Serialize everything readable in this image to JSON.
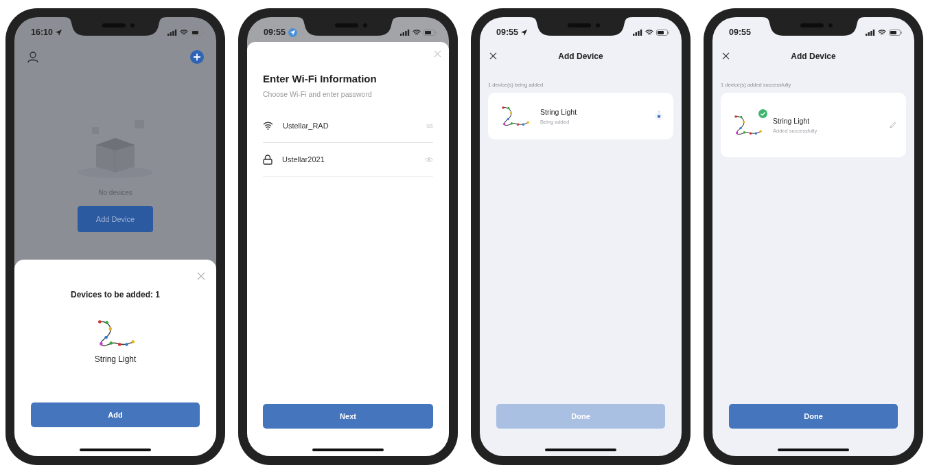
{
  "phones": [
    {
      "kind": "home_sheet",
      "time": "16:10",
      "location_icon": {
        "kind": "arrow"
      },
      "empty_text": "No devices",
      "home_button": "Add Device",
      "sheet_title": "Devices to be added: 1",
      "device_name": "String Light",
      "sheet_button": "Add"
    },
    {
      "kind": "wifi_form",
      "time": "09:55",
      "location_icon": {
        "kind": "badge"
      },
      "title": "Enter Wi-Fi Information",
      "subtitle": "Choose Wi-Fi and enter password",
      "fields": [
        {
          "kind": "network",
          "value": "Ustellar_RAD"
        },
        {
          "kind": "password",
          "value": "Ustellar2021"
        }
      ],
      "button": "Next"
    },
    {
      "kind": "progress",
      "time": "09:55",
      "location_icon": {
        "kind": "arrow"
      },
      "title": "Add Device",
      "status_text": "1 device(s) being added",
      "device": {
        "name": "String Light",
        "status": "Being added",
        "added": false
      },
      "button": {
        "label": "Done",
        "disabled": true
      }
    },
    {
      "kind": "progress",
      "time": "09:55",
      "title": "Add Device",
      "status_text": "1 device(s) added successfully",
      "device": {
        "name": "String Light",
        "status": "Added successfully",
        "added": true
      },
      "button": {
        "label": "Done",
        "disabled": false
      }
    }
  ]
}
